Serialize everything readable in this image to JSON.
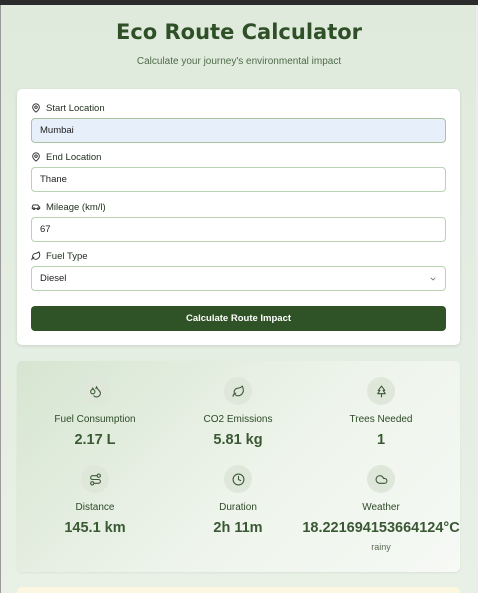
{
  "header": {
    "title": "Eco Route Calculator",
    "subtitle": "Calculate your journey's environmental impact"
  },
  "form": {
    "start": {
      "label": "Start Location",
      "value": "Mumbai",
      "icon": "map-pin-icon"
    },
    "end": {
      "label": "End Location",
      "value": "Thane",
      "icon": "map-pin-icon"
    },
    "mileage": {
      "label": "Mileage (km/l)",
      "value": "67",
      "icon": "car-icon"
    },
    "fuel": {
      "label": "Fuel Type",
      "value": "Diesel",
      "icon": "leaf-icon"
    },
    "button_label": "Calculate Route Impact"
  },
  "results": {
    "fuel": {
      "label": "Fuel Consumption",
      "value": "2.17 L",
      "icon": "droplets-icon"
    },
    "co2": {
      "label": "CO2 Emissions",
      "value": "5.81 kg",
      "icon": "leaf-icon"
    },
    "trees": {
      "label": "Trees Needed",
      "value": "1",
      "icon": "tree-icon"
    },
    "distance": {
      "label": "Distance",
      "value": "145.1 km",
      "icon": "route-icon"
    },
    "duration": {
      "label": "Duration",
      "value": "2h 11m",
      "icon": "clock-icon"
    },
    "weather": {
      "label": "Weather",
      "value": "18.221694153664124°C",
      "sub": "rainy",
      "icon": "cloud-icon"
    }
  },
  "colors": {
    "primary": "#2f5227",
    "title": "#2f5027",
    "value": "#3a5834",
    "page_bg": "#e3ece0",
    "input_border": "#b9d2b3",
    "input_active_bg": "#e7effb"
  }
}
